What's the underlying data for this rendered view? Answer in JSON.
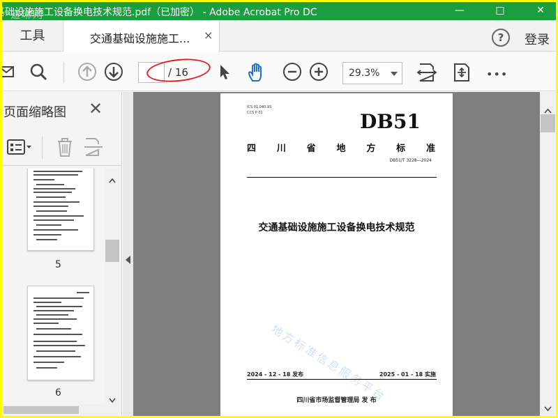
{
  "window": {
    "title": "基础设施施工设备换电技术规范.pdf（已加密） - Adobe Acrobat Pro DC",
    "watermark": "道琳网",
    "controls": {
      "minimize": "—",
      "maximize": "□",
      "close": "✕"
    }
  },
  "tabs": {
    "tools_label": "工具",
    "document_label": "交通基础设施施工...",
    "close_label": "×"
  },
  "header": {
    "help_label": "?",
    "login_label": "登录"
  },
  "toolbar": {
    "current_page": "",
    "page_total": "/ 16",
    "zoom": "29.3%",
    "more_label": "•••"
  },
  "sidebar": {
    "title": "页面缩略图",
    "close_label": "✕",
    "thumbnails": [
      {
        "number": "5"
      },
      {
        "number": "6"
      }
    ]
  },
  "document": {
    "ics": "ICS  01.040.93",
    "ccs": "CCS  P  01",
    "code": "DB51",
    "province_chars": [
      "四",
      "川",
      "省",
      "地",
      "方",
      "标",
      "准"
    ],
    "standard_number": "DB51/T 3228—2024",
    "title": "交通基础设施施工设备换电技术规范",
    "watermark": "地方标准信息服务平台",
    "publish_date": "2024 - 12 - 18 发布",
    "implement_date": "2025 - 01 - 18 实施",
    "issuer": "四川省市场监督管理局    发 布"
  },
  "colors": {
    "titlebar": "#1a9e3f",
    "highlight_ellipse": "#e02020",
    "frame_border": "#ffff00",
    "canvas": "#7f7f7f"
  }
}
